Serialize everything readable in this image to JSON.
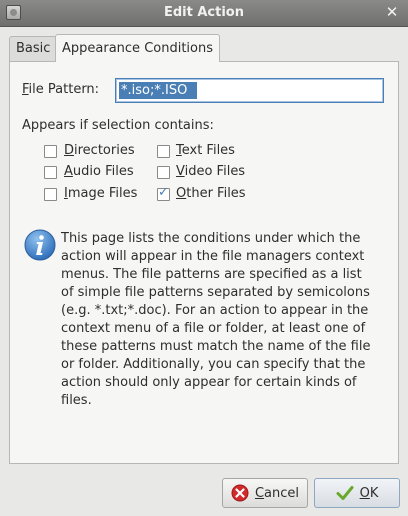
{
  "window": {
    "title": "Edit Action",
    "close_symbol": "✕"
  },
  "tabs": [
    {
      "label": "Basic",
      "active": false
    },
    {
      "label": "Appearance Conditions",
      "active": true
    }
  ],
  "file_pattern": {
    "label_mnemonic": "F",
    "label_rest": "ile Pattern:",
    "value": "*.iso;*.ISO"
  },
  "appears_label": "Appears if selection contains:",
  "checkboxes": [
    {
      "mnemonic": "D",
      "rest": "irectories",
      "checked": false
    },
    {
      "mnemonic": "T",
      "rest": "ext Files",
      "checked": false
    },
    {
      "mnemonic": "A",
      "rest": "udio Files",
      "checked": false
    },
    {
      "mnemonic": "V",
      "rest": "ideo Files",
      "checked": false
    },
    {
      "mnemonic": "I",
      "rest": "mage Files",
      "checked": false
    },
    {
      "mnemonic": "O",
      "rest": "ther Files",
      "checked": true
    }
  ],
  "info": {
    "icon": "info-icon",
    "lines": [
      "This page lists the conditions under which the",
      "action will appear in the file managers context",
      "menus. The file patterns are specified as a list",
      "of simple file patterns separated by semicolons",
      "(e.g. *.txt;*.doc). For an action to appear in the",
      "context menu of a file or folder, at least one of",
      "these patterns must match the name of the file",
      "or folder. Additionally, you can specify that the",
      "action should only appear for certain kinds of",
      "files."
    ]
  },
  "buttons": {
    "cancel_mnemonic": "C",
    "cancel_rest": "ancel",
    "ok_mnemonic": "O",
    "ok_rest": "K"
  },
  "colors": {
    "selection": "#4a7fb5",
    "info_blue": "#3b79c4",
    "cancel_red": "#d22a2a",
    "ok_green": "#6aa82c"
  }
}
